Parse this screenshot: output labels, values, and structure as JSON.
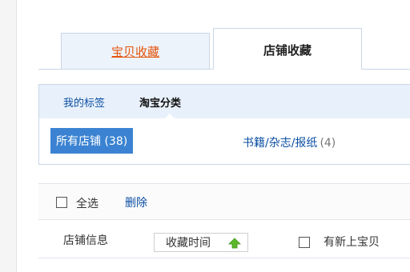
{
  "tabs": {
    "favorite_items": "宝贝收藏",
    "favorite_shops": "店铺收藏"
  },
  "filter": {
    "my_tags": "我的标签",
    "taobao_category": "淘宝分类",
    "all_shops": "所有店铺 (38)",
    "books_name": "书籍/杂志/报纸",
    "books_count": "(4)"
  },
  "actions": {
    "select_all": "全选",
    "delete": "删除"
  },
  "sort": {
    "shop_info": "店铺信息",
    "fav_time": "收藏时间",
    "has_new": "有新上宝贝"
  },
  "colors": {
    "active_category_bg": "#3b83d2",
    "link": "#0b4fa3",
    "tab_inactive_text": "#e4540c",
    "sort_arrow": "#5cb82a"
  }
}
